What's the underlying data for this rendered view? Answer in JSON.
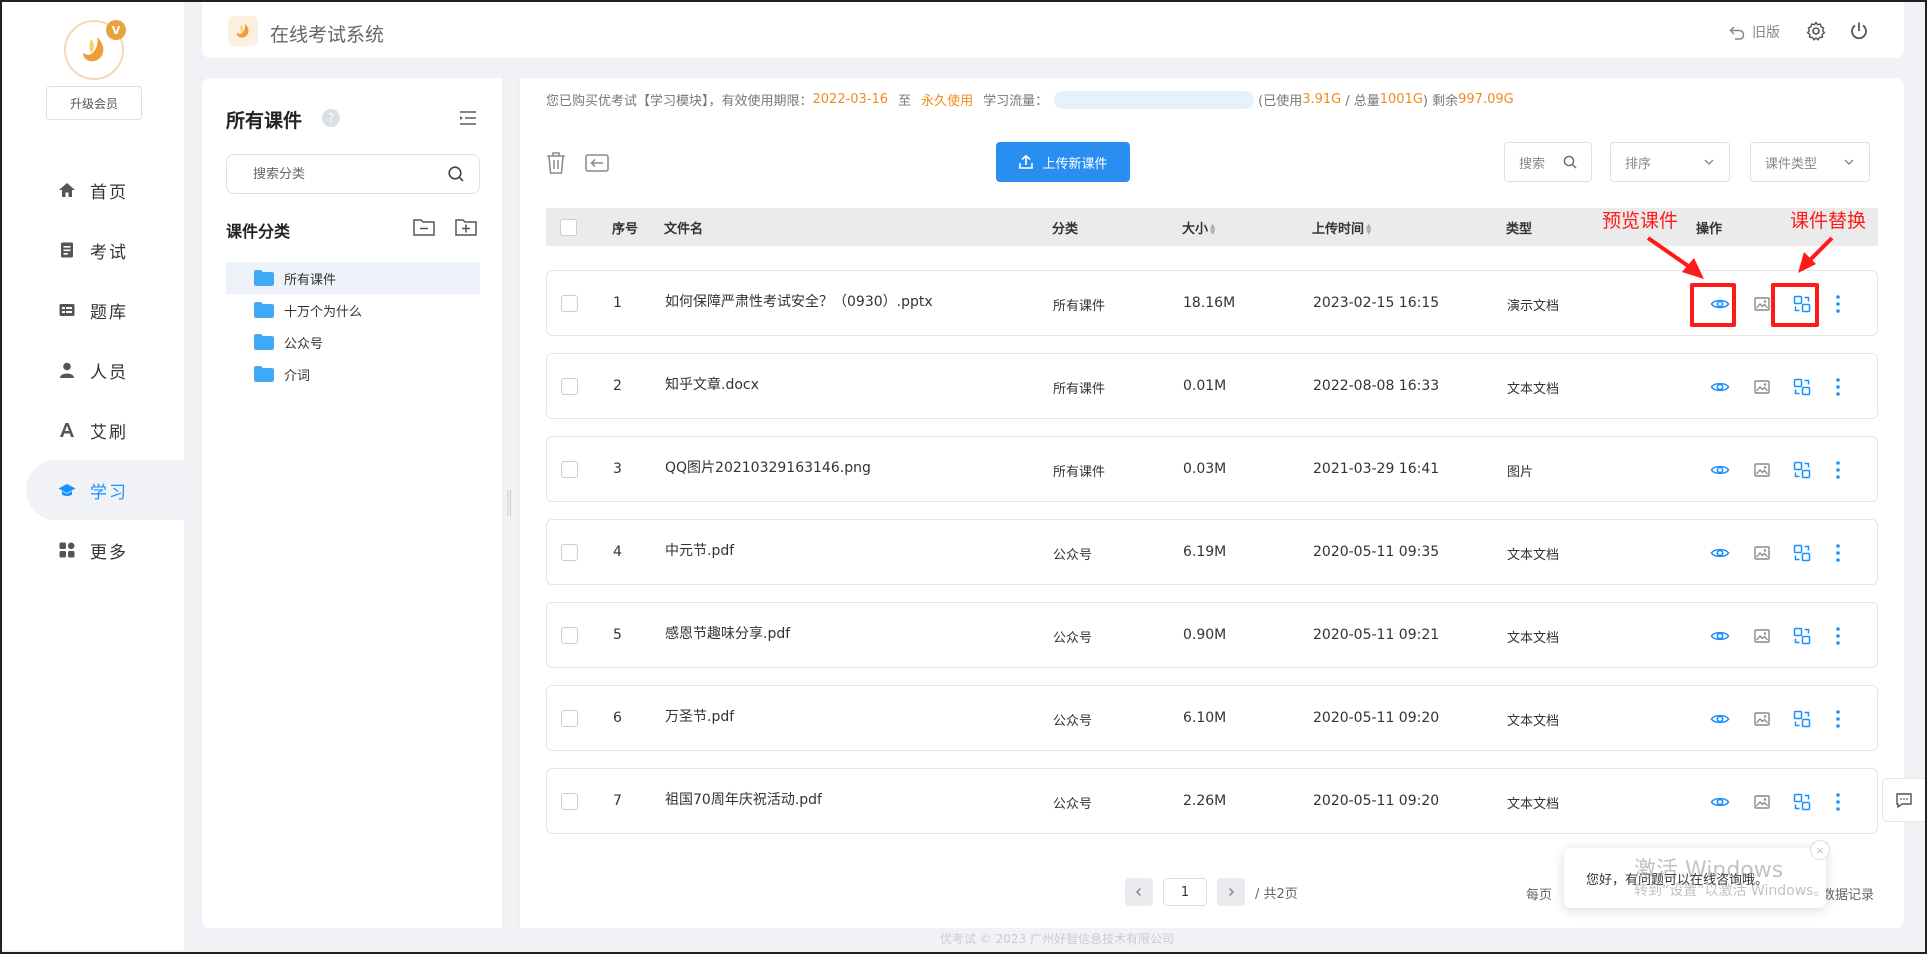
{
  "sidebar": {
    "vip_badge": "V",
    "upgrade_label": "升级会员",
    "items": [
      {
        "label": "首页",
        "icon": "home-icon"
      },
      {
        "label": "考试",
        "icon": "exam-icon"
      },
      {
        "label": "题库",
        "icon": "question-bank-icon"
      },
      {
        "label": "人员",
        "icon": "user-icon"
      },
      {
        "label": "艾刷",
        "icon": "font-icon"
      },
      {
        "label": "学习",
        "icon": "graduation-cap-icon"
      },
      {
        "label": "更多",
        "icon": "apps-icon"
      }
    ],
    "active_index": 5
  },
  "header": {
    "app_title": "在线考试系统",
    "old_version_label": "旧版"
  },
  "category_panel": {
    "title": "所有课件",
    "help_icon": "?",
    "search_placeholder": "搜索分类",
    "subtitle": "课件分类",
    "tree": [
      {
        "label": "所有课件",
        "active": true
      },
      {
        "label": "十万个为什么",
        "active": false
      },
      {
        "label": "公众号",
        "active": false
      },
      {
        "label": "介词",
        "active": false
      }
    ]
  },
  "notice": {
    "prefix": "您已购买优考试【学习模块】，有效使用期限：",
    "start_date": "2022-03-16",
    "to": "至",
    "end_date": "永久使用",
    "traffic_label": "学习流量：",
    "used_prefix": "(已使用",
    "used_value": "3.91G",
    "total_prefix": "/ 总量",
    "total_value": "1001G",
    "remain_prefix": ")  剩余",
    "remain_value": "997.09G"
  },
  "toolbar": {
    "upload_label": "上传新课件",
    "search_label": "搜索",
    "sort_label": "排序",
    "type_label": "课件类型"
  },
  "table": {
    "headers": {
      "index": "序号",
      "name": "文件名",
      "category": "分类",
      "size": "大小",
      "upload_time": "上传时间",
      "type": "类型",
      "actions": "操作"
    },
    "rows": [
      {
        "index": "1",
        "name": "如何保障严肃性考试安全？（0930）.pptx",
        "category": "所有课件",
        "size": "18.16M",
        "time": "2023-02-15 16:15",
        "type": "演示文档"
      },
      {
        "index": "2",
        "name": "知乎文章.docx",
        "category": "所有课件",
        "size": "0.01M",
        "time": "2022-08-08 16:33",
        "type": "文本文档"
      },
      {
        "index": "3",
        "name": "QQ图片20210329163146.png",
        "category": "所有课件",
        "size": "0.03M",
        "time": "2021-03-29 16:41",
        "type": "图片"
      },
      {
        "index": "4",
        "name": "中元节.pdf",
        "category": "公众号",
        "size": "6.19M",
        "time": "2020-05-11 09:35",
        "type": "文本文档"
      },
      {
        "index": "5",
        "name": "感恩节趣味分享.pdf",
        "category": "公众号",
        "size": "0.90M",
        "time": "2020-05-11 09:21",
        "type": "文本文档"
      },
      {
        "index": "6",
        "name": "万圣节.pdf",
        "category": "公众号",
        "size": "6.10M",
        "time": "2020-05-11 09:20",
        "type": "文本文档"
      },
      {
        "index": "7",
        "name": "祖国70周年庆祝活动.pdf",
        "category": "公众号",
        "size": "2.26M",
        "time": "2020-05-11 09:20",
        "type": "文本文档"
      }
    ]
  },
  "annotations": {
    "preview": "预览课件",
    "replace": "课件替换"
  },
  "pagination": {
    "current": "1",
    "total_label": "/ 共2页",
    "per_page_label": "每页",
    "data_record_label": "数据记录"
  },
  "footer": {
    "copyright": "优考试 © 2023 广州好智信息技术有限公司"
  },
  "chat": {
    "message": "您好，有问题可以在线咨询哦。",
    "close": "×"
  },
  "watermark": {
    "line1": "激活 Windows",
    "line2": "转到“设置”以激活 Windows。"
  },
  "colors": {
    "accent": "#1890ff",
    "upload_button": "#2a8df0",
    "orange": "#f08c1e",
    "annotation_red": "#ff1a1a"
  }
}
